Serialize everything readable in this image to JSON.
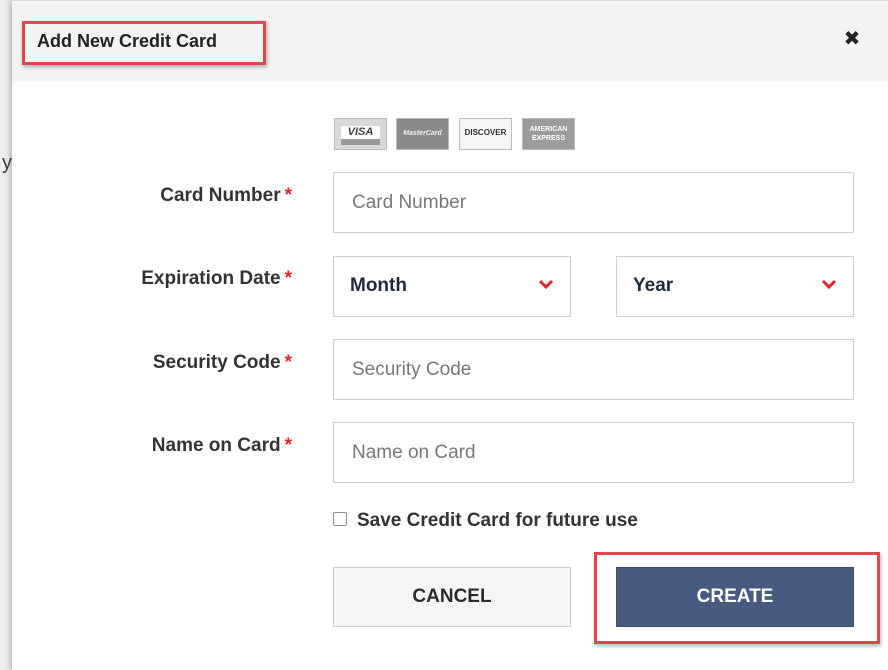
{
  "modal": {
    "title": "Add New Credit Card",
    "close_glyph": "✖"
  },
  "page_edge_glyph": "y",
  "card_logos": [
    {
      "name": "visa-logo",
      "text": "VISA"
    },
    {
      "name": "mastercard-logo",
      "text": "MasterCard"
    },
    {
      "name": "discover-logo",
      "text": "DISCOVER"
    },
    {
      "name": "amex-logo",
      "text": "AMERICAN EXPRESS"
    }
  ],
  "form": {
    "required_mark": "*",
    "card_number": {
      "label": "Card Number",
      "placeholder": "Card Number",
      "value": ""
    },
    "expiration": {
      "label": "Expiration Date",
      "month": "Month",
      "year": "Year"
    },
    "security_code": {
      "label": "Security Code",
      "placeholder": "Security Code",
      "value": ""
    },
    "name_on_card": {
      "label": "Name on Card",
      "placeholder": "Name on Card",
      "value": ""
    },
    "save_card": {
      "label": "Save Credit Card for future use",
      "checked": false
    }
  },
  "buttons": {
    "cancel": "CANCEL",
    "create": "CREATE"
  },
  "colors": {
    "required": "#e0262c",
    "highlight": "#e0464b",
    "primary_button": "#475b80",
    "chevron": "#e0262c"
  }
}
